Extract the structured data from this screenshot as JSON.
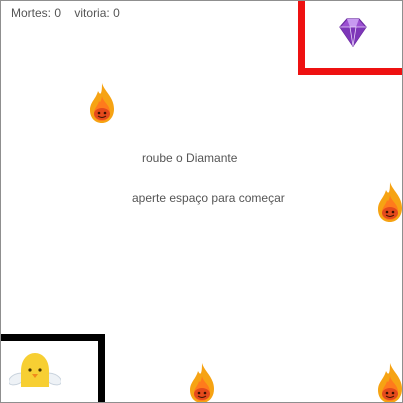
{
  "hud": {
    "deaths_label": "Mortes:",
    "deaths_value": "0",
    "wins_label": "vitoria:",
    "wins_value": "0"
  },
  "messages": {
    "objective": "roube o Diamante",
    "instruction": "aperte espaço para começar"
  },
  "colors": {
    "goal_border": "#ee1111",
    "start_border": "#000000",
    "diamond": "#9b4fd1",
    "flame_outer": "#f6a313",
    "flame_inner": "#e44a1c",
    "player": "#f7cf33"
  },
  "sprites": {
    "goal_icon": "diamond-icon",
    "hazard_icon": "flame-icon",
    "player_icon": "chick-icon"
  }
}
